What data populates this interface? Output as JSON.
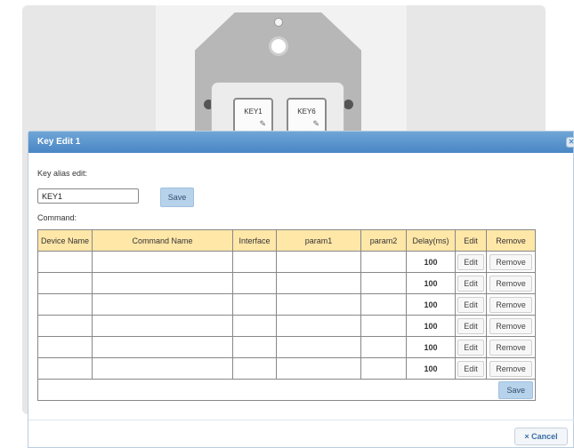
{
  "device": {
    "key_left": "KEY1",
    "key_right": "KEY6",
    "edit_icon": "edit-icon"
  },
  "dialog": {
    "title": "Key Edit 1",
    "close_icon": "close-icon",
    "alias_label": "Key alias edit:",
    "alias_value": "KEY1",
    "save_label": "Save",
    "command_label": "Command:",
    "cancel_label": "× Cancel"
  },
  "table": {
    "headers": [
      "Device Name",
      "Command Name",
      "Interface",
      "param1",
      "param2",
      "Delay(ms)",
      "Edit",
      "Remove"
    ],
    "rows": [
      {
        "device": "",
        "command": "",
        "interface": "",
        "param1": "",
        "param2": "",
        "delay": "100",
        "edit": "Edit",
        "remove": "Remove"
      },
      {
        "device": "",
        "command": "",
        "interface": "",
        "param1": "",
        "param2": "",
        "delay": "100",
        "edit": "Edit",
        "remove": "Remove"
      },
      {
        "device": "",
        "command": "",
        "interface": "",
        "param1": "",
        "param2": "",
        "delay": "100",
        "edit": "Edit",
        "remove": "Remove"
      },
      {
        "device": "",
        "command": "",
        "interface": "",
        "param1": "",
        "param2": "",
        "delay": "100",
        "edit": "Edit",
        "remove": "Remove"
      },
      {
        "device": "",
        "command": "",
        "interface": "",
        "param1": "",
        "param2": "",
        "delay": "100",
        "edit": "Edit",
        "remove": "Remove"
      },
      {
        "device": "",
        "command": "",
        "interface": "",
        "param1": "",
        "param2": "",
        "delay": "100",
        "edit": "Edit",
        "remove": "Remove"
      }
    ],
    "save_label": "Save"
  },
  "colors": {
    "header_blue": "#4a86c5",
    "table_header": "#ffe7a8",
    "button_blue": "#b7d3ec"
  }
}
